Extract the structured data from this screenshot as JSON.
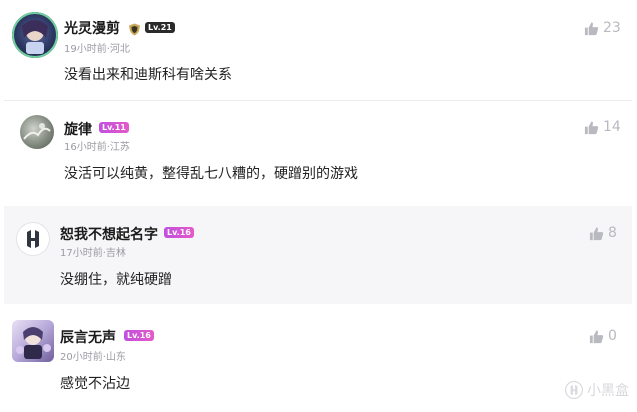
{
  "comments": [
    {
      "username": "光灵漫剪",
      "level": "Lv.21",
      "meta": "19小时前·河北",
      "text": "没看出来和迪斯科有啥关系",
      "likes": "23"
    },
    {
      "username": "旋律",
      "level": "Lv.11",
      "meta": "16小时前·江苏",
      "text": "没活可以纯黄，整得乱七八糟的，硬蹭别的游戏",
      "likes": "14"
    },
    {
      "username": "恕我不想起名字",
      "level": "Lv.16",
      "meta": "17小时前·吉林",
      "text": "没绷住，就纯硬蹭",
      "likes": "8"
    },
    {
      "username": "辰言无声",
      "level": "Lv.16",
      "meta": "20小时前·山东",
      "text": "感觉不沾边",
      "likes": "0"
    }
  ],
  "watermark": {
    "text": "小黑盒"
  },
  "icons": {
    "like": "thumbs-up-icon",
    "verified": "shield-icon",
    "avatar_placeholder": "heybox-logo-icon"
  },
  "colors": {
    "level_badge_high": "#2a2a2a",
    "level_badge": "#d052d8",
    "like_gray": "#b9b9c0",
    "meta_gray": "#9a9aa2",
    "highlight_row": "#f6f6f8"
  }
}
